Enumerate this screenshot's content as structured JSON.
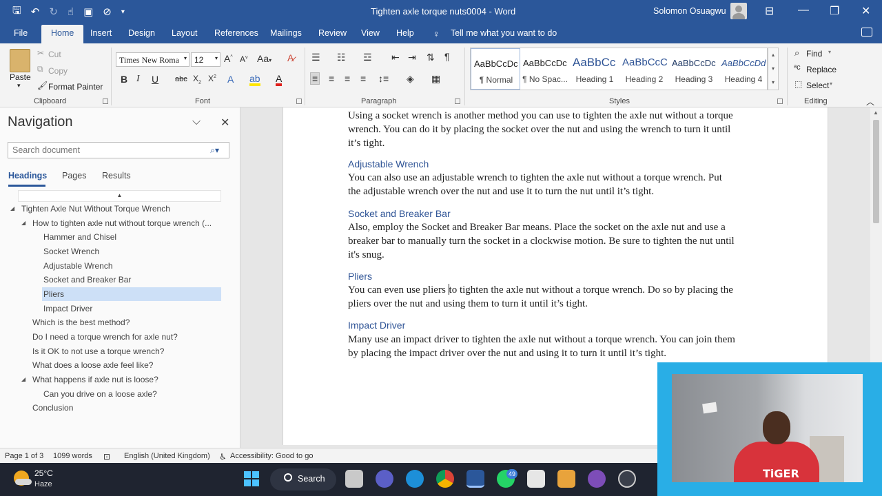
{
  "window": {
    "title": "Tighten axle torque nuts0004  -  Word",
    "user": "Solomon Osuagwu"
  },
  "tabs": [
    "File",
    "Home",
    "Insert",
    "Design",
    "Layout",
    "References",
    "Mailings",
    "Review",
    "View",
    "Help"
  ],
  "tell_me": "Tell me what you want to do",
  "ribbon": {
    "clipboard": {
      "paste": "Paste",
      "cut": "Cut",
      "copy": "Copy",
      "format_painter": "Format Painter",
      "label": "Clipboard"
    },
    "font": {
      "name": "Times New Roma",
      "size": "12",
      "label": "Font"
    },
    "paragraph": {
      "label": "Paragraph"
    },
    "styles": {
      "label": "Styles",
      "items": [
        {
          "sample": "AaBbCcDc",
          "name": "¶ Normal"
        },
        {
          "sample": "AaBbCcDc",
          "name": "¶ No Spac..."
        },
        {
          "sample": "AaBbCc",
          "name": "Heading 1"
        },
        {
          "sample": "AaBbCcC",
          "name": "Heading 2"
        },
        {
          "sample": "AaBbCcDc",
          "name": "Heading 3"
        },
        {
          "sample": "AaBbCcDd",
          "name": "Heading 4"
        }
      ]
    },
    "editing": {
      "find": "Find",
      "replace": "Replace",
      "select": "Select",
      "label": "Editing"
    }
  },
  "navigation": {
    "title": "Navigation",
    "search_placeholder": "Search document",
    "tabs": [
      "Headings",
      "Pages",
      "Results"
    ],
    "tree": [
      "Tighten Axle Nut Without Torque Wrench",
      "How to tighten axle nut without torque wrench (...",
      "Hammer and Chisel",
      "Socket Wrench",
      "Adjustable Wrench",
      "Socket and Breaker Bar",
      "Pliers",
      "Impact Driver",
      "Which is the best method?",
      "Do I need a torque wrench for axle nut?",
      "Is it OK to not use a torque wrench?",
      "What does a loose axle feel like?",
      "What happens if axle nut is loose?",
      "Can you drive on a loose axle?",
      "Conclusion"
    ]
  },
  "document": {
    "intro_lines": [
      "Using a socket wrench is another method you can use to tighten the axle nut without a torque",
      "wrench. You can do it by placing the socket over the nut and using the wrench to turn it until",
      "it’s tight."
    ],
    "h_adjustable": "Adjustable Wrench",
    "adjustable_lines": [
      "You can also use an adjustable wrench to tighten the axle nut without a torque wrench. Put",
      "the adjustable wrench over the nut and use it to turn the nut until it’s tight."
    ],
    "h_breaker": "Socket and Breaker Bar",
    "breaker_lines": [
      "Also, employ the Socket and Breaker Bar means. Place the socket on the axle nut and use a",
      "breaker bar to manually turn the socket in a clockwise motion. Be sure to tighten the nut until",
      "it's snug."
    ],
    "h_pliers": "Pliers",
    "pliers_line1_a": "You can even use pliers ",
    "pliers_line1_b": "to tighten the axle nut without a torque wrench. Do so by placing the",
    "pliers_line2": "pliers over the nut and using them to turn it until it’s tight.",
    "h_impact": "Impact Driver",
    "impact_lines": [
      "Many use an impact driver to tighten the axle nut without a torque wrench. You can join them",
      "by placing the impact driver over the nut and using it to turn it until it’s tight."
    ]
  },
  "status": {
    "page": "Page 1 of 3",
    "words": "1099 words",
    "language": "English (United Kingdom)",
    "accessibility": "Accessibility: Good to go"
  },
  "taskbar": {
    "temp": "25°C",
    "condition": "Haze",
    "search": "Search",
    "whatsapp_badge": "49"
  },
  "webcam": {
    "shirt_text": "TiGER"
  },
  "colors": {
    "accent": "#2b579a",
    "heading": "#2f5496",
    "selection": "#cde0f7"
  }
}
